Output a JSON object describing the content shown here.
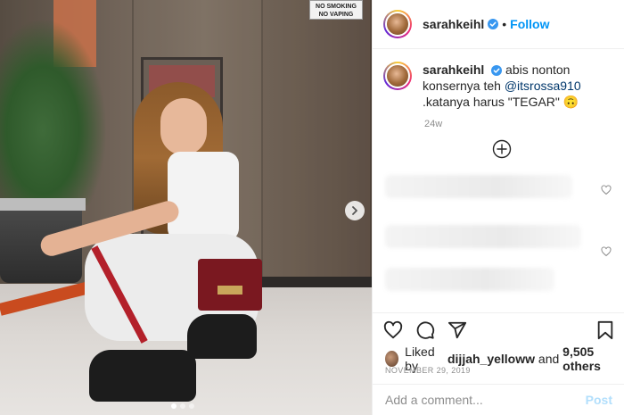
{
  "photo": {
    "sign_line1": "NO SMOKING",
    "sign_line2": "NO VAPING",
    "carousel_total": 3,
    "carousel_active": 1
  },
  "header": {
    "username": "sarahkeihl",
    "separator": "•",
    "follow_label": "Follow",
    "more_icon": "more-horizontal-icon"
  },
  "caption": {
    "username": "sarahkeihl",
    "text_before": " abis nonton konsernya teh ",
    "mention": "@itsrossa910",
    "text_after": " .katanya harus \"TEGAR\" 🙃",
    "age": "24w"
  },
  "icons": {
    "load_more": "plus-circle-icon",
    "like": "heart-icon",
    "comment": "comment-icon",
    "share": "paper-plane-icon",
    "save": "bookmark-icon",
    "verified": "verified-badge-icon"
  },
  "likes": {
    "prefix": "Liked by ",
    "user": "dijjah_yelloww",
    "and": " and ",
    "others": "9,505 others"
  },
  "post_date": "NOVEMBER 29, 2019",
  "comment_box": {
    "placeholder": "Add a comment...",
    "post_label": "Post"
  },
  "colors": {
    "accent": "#0095f6",
    "post_disabled": "#b2dffc",
    "mention": "#00376b",
    "muted": "#8e8e8e"
  }
}
